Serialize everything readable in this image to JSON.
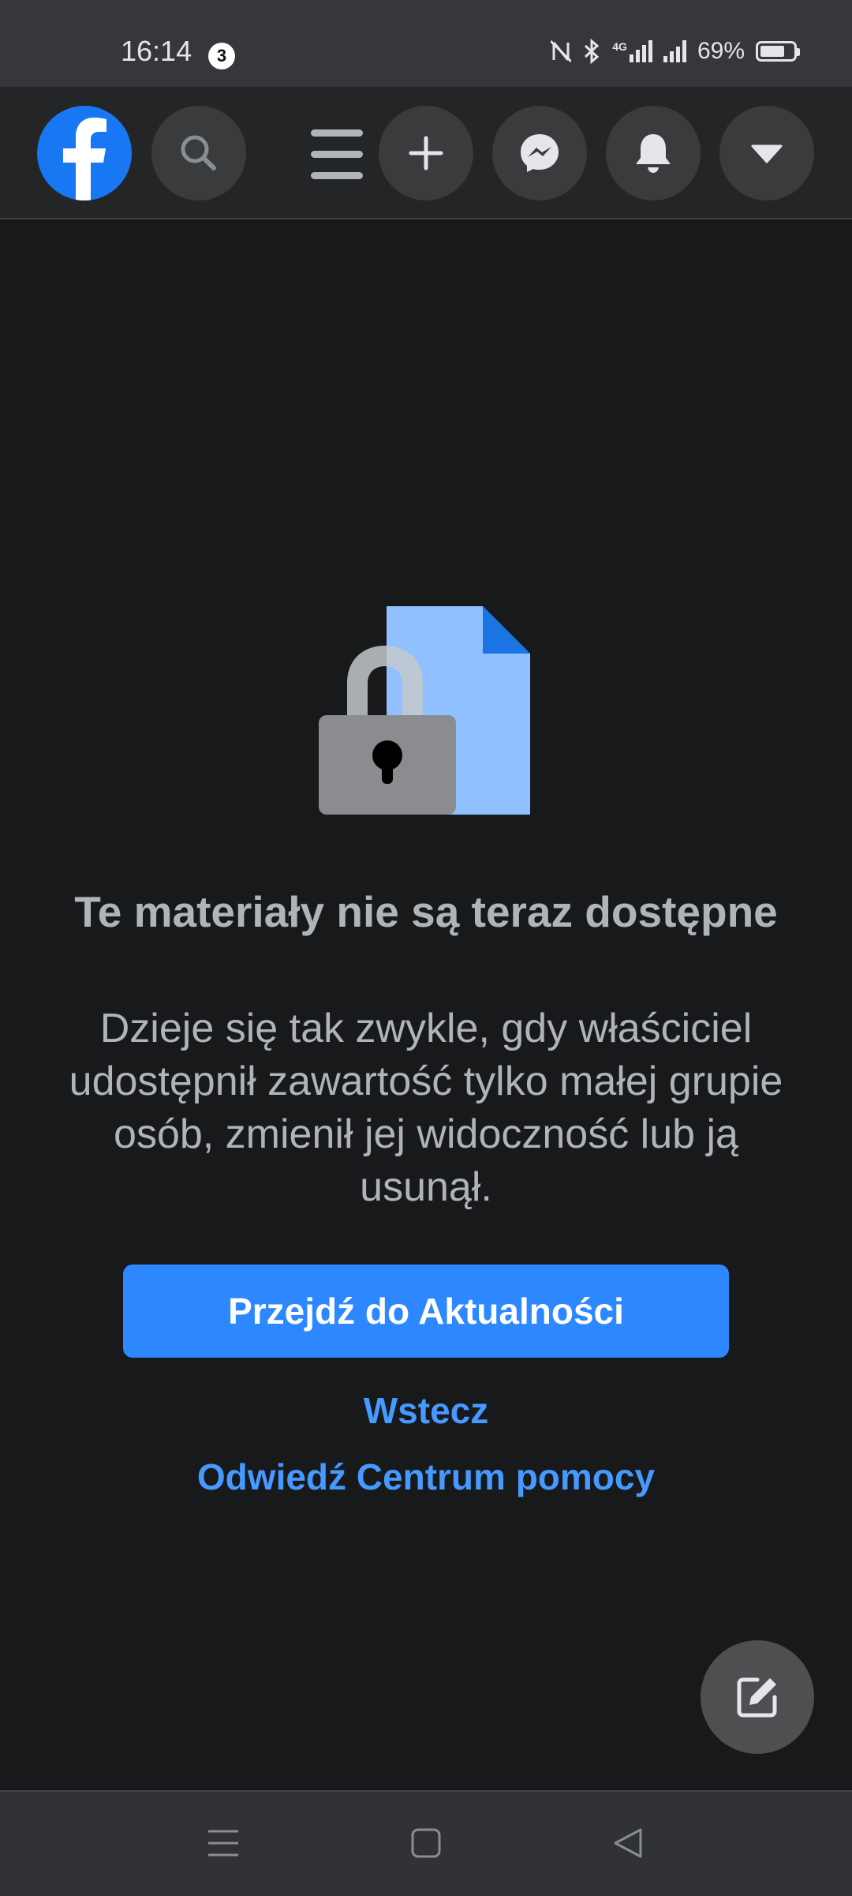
{
  "status_bar": {
    "time": "16:14",
    "notification_count": "3",
    "network": "4G",
    "battery_percent": "69%"
  },
  "header": {
    "icons": [
      "facebook-logo",
      "search-icon",
      "menu-icon",
      "plus-icon",
      "messenger-icon",
      "bell-icon",
      "caret-down-icon"
    ]
  },
  "content": {
    "title": "Te materiały nie są teraz dostępne",
    "description": "Dzieje się tak zwykle, gdy właściciel udostępnił zawartość tylko małej grupie osób, zmienił jej widoczność lub ją usunął.",
    "primary_button": "Przejdź do Aktualności",
    "back_link": "Wstecz",
    "help_link": "Odwiedź Centrum pomocy"
  },
  "fab": {
    "icon": "compose-icon"
  },
  "nav_bar": {
    "icons": [
      "recent-apps-icon",
      "home-icon",
      "back-icon"
    ]
  },
  "colors": {
    "background": "#18191a",
    "header": "#242526",
    "brand": "#1877f2",
    "button": "#2d88ff",
    "link": "#4599ff"
  }
}
